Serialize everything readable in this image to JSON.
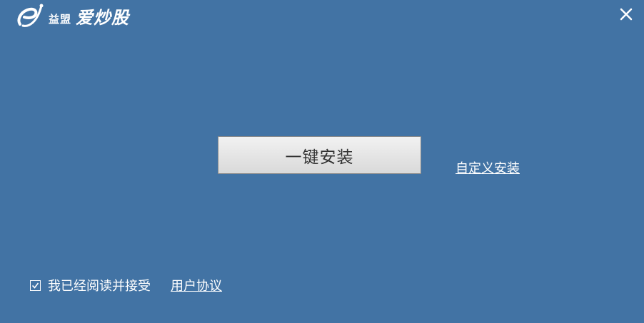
{
  "header": {
    "brand_small": "益盟",
    "brand_big": "爱炒股",
    "logo_icon": "e-swoosh-logo-icon",
    "close_icon": "close-icon"
  },
  "main": {
    "install_label": "一键安装",
    "custom_install_label": "自定义安装"
  },
  "footer": {
    "agree_checked": true,
    "agree_label": "我已经阅读并接受",
    "agreement_link": "用户协议"
  },
  "colors": {
    "background": "#4273a4",
    "button_face": "#e6e6e6",
    "text_light": "#ffffff"
  }
}
